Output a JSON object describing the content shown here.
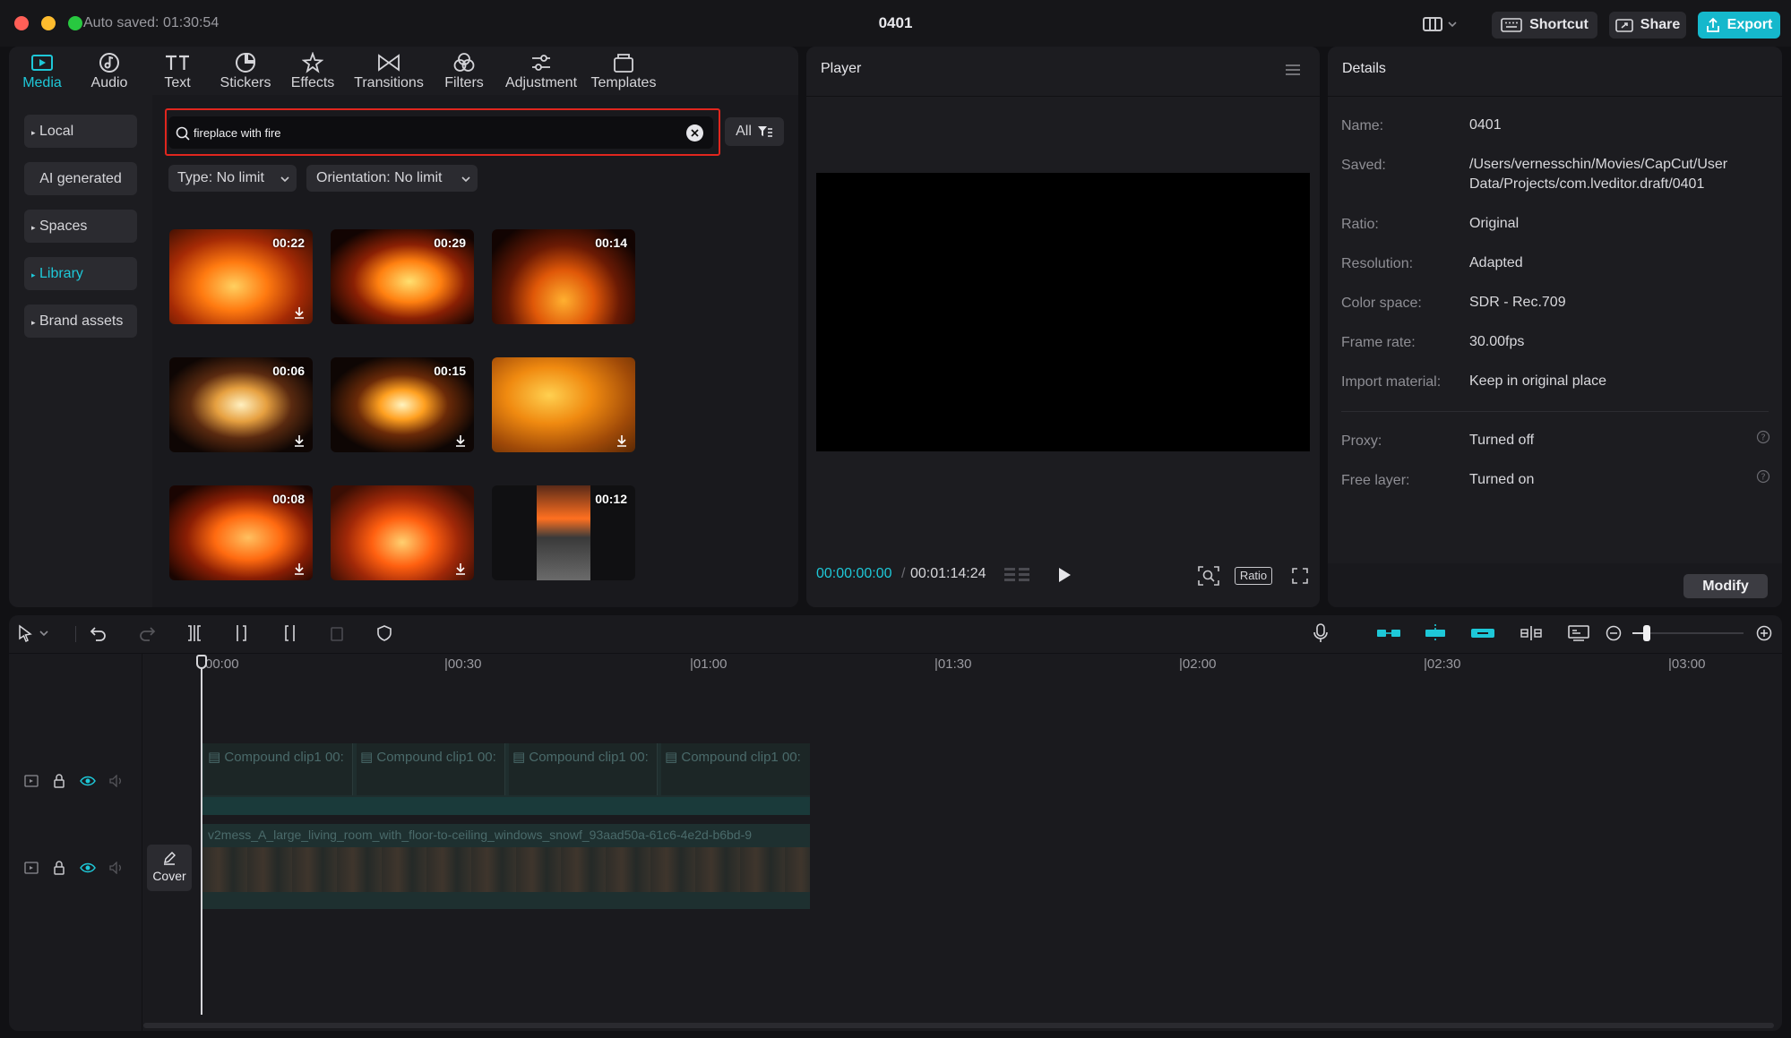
{
  "window": {
    "title": "0401",
    "autosave": "Auto saved: 01:30:54"
  },
  "topbar": {
    "shortcut": "Shortcut",
    "share": "Share",
    "export": "Export"
  },
  "tabs": [
    {
      "label": "Media",
      "icon": "media-icon"
    },
    {
      "label": "Audio",
      "icon": "audio-icon"
    },
    {
      "label": "Text",
      "icon": "text-icon"
    },
    {
      "label": "Stickers",
      "icon": "stickers-icon"
    },
    {
      "label": "Effects",
      "icon": "effects-icon"
    },
    {
      "label": "Transitions",
      "icon": "transitions-icon"
    },
    {
      "label": "Filters",
      "icon": "filters-icon"
    },
    {
      "label": "Adjustment",
      "icon": "adjustment-icon"
    },
    {
      "label": "Templates",
      "icon": "templates-icon"
    }
  ],
  "sidebar": [
    "Local",
    "AI generated",
    "Spaces",
    "Library",
    "Brand assets"
  ],
  "search": {
    "value": "fireplace with fire",
    "filter": "All"
  },
  "filters": {
    "type": "Type: No limit",
    "orientation": "Orientation: No limit"
  },
  "thumbs": [
    {
      "duration": "00:22",
      "download": true
    },
    {
      "duration": "00:29",
      "download": false
    },
    {
      "duration": "00:14",
      "download": false
    },
    {
      "duration": "00:06",
      "download": true
    },
    {
      "duration": "00:15",
      "download": true
    },
    {
      "duration": "",
      "download": true
    },
    {
      "duration": "00:08",
      "download": true
    },
    {
      "duration": "",
      "download": true
    },
    {
      "duration": "00:12",
      "download": false
    }
  ],
  "player": {
    "title": "Player",
    "current": "00:00:00:00",
    "total": "00:01:14:24",
    "ratio": "Ratio"
  },
  "details": {
    "title": "Details",
    "rows": [
      {
        "label": "Name:",
        "value": "0401"
      },
      {
        "label": "Saved:",
        "value": "/Users/vernesschin/Movies/CapCut/User Data/Projects/com.lveditor.draft/0401"
      },
      {
        "label": "Ratio:",
        "value": "Original"
      },
      {
        "label": "Resolution:",
        "value": "Adapted"
      },
      {
        "label": "Color space:",
        "value": "SDR - Rec.709"
      },
      {
        "label": "Frame rate:",
        "value": "30.00fps"
      },
      {
        "label": "Import material:",
        "value": "Keep in original place"
      }
    ],
    "rows2": [
      {
        "label": "Proxy:",
        "value": "Turned off"
      },
      {
        "label": "Free layer:",
        "value": "Turned on"
      }
    ],
    "modify": "Modify"
  },
  "timeline": {
    "ruler": [
      "00:00",
      "|00:30",
      "|01:00",
      "|01:30",
      "|02:00",
      "|02:30",
      "|03:00"
    ],
    "compound_label": "Compound clip1",
    "compound_tail": "00:",
    "main_clip": "v2mess_A_large_living_room_with_floor-to-ceiling_windows_snowf_93aad50a-61c6-4e2d-b6bd-9",
    "cover": "Cover"
  }
}
